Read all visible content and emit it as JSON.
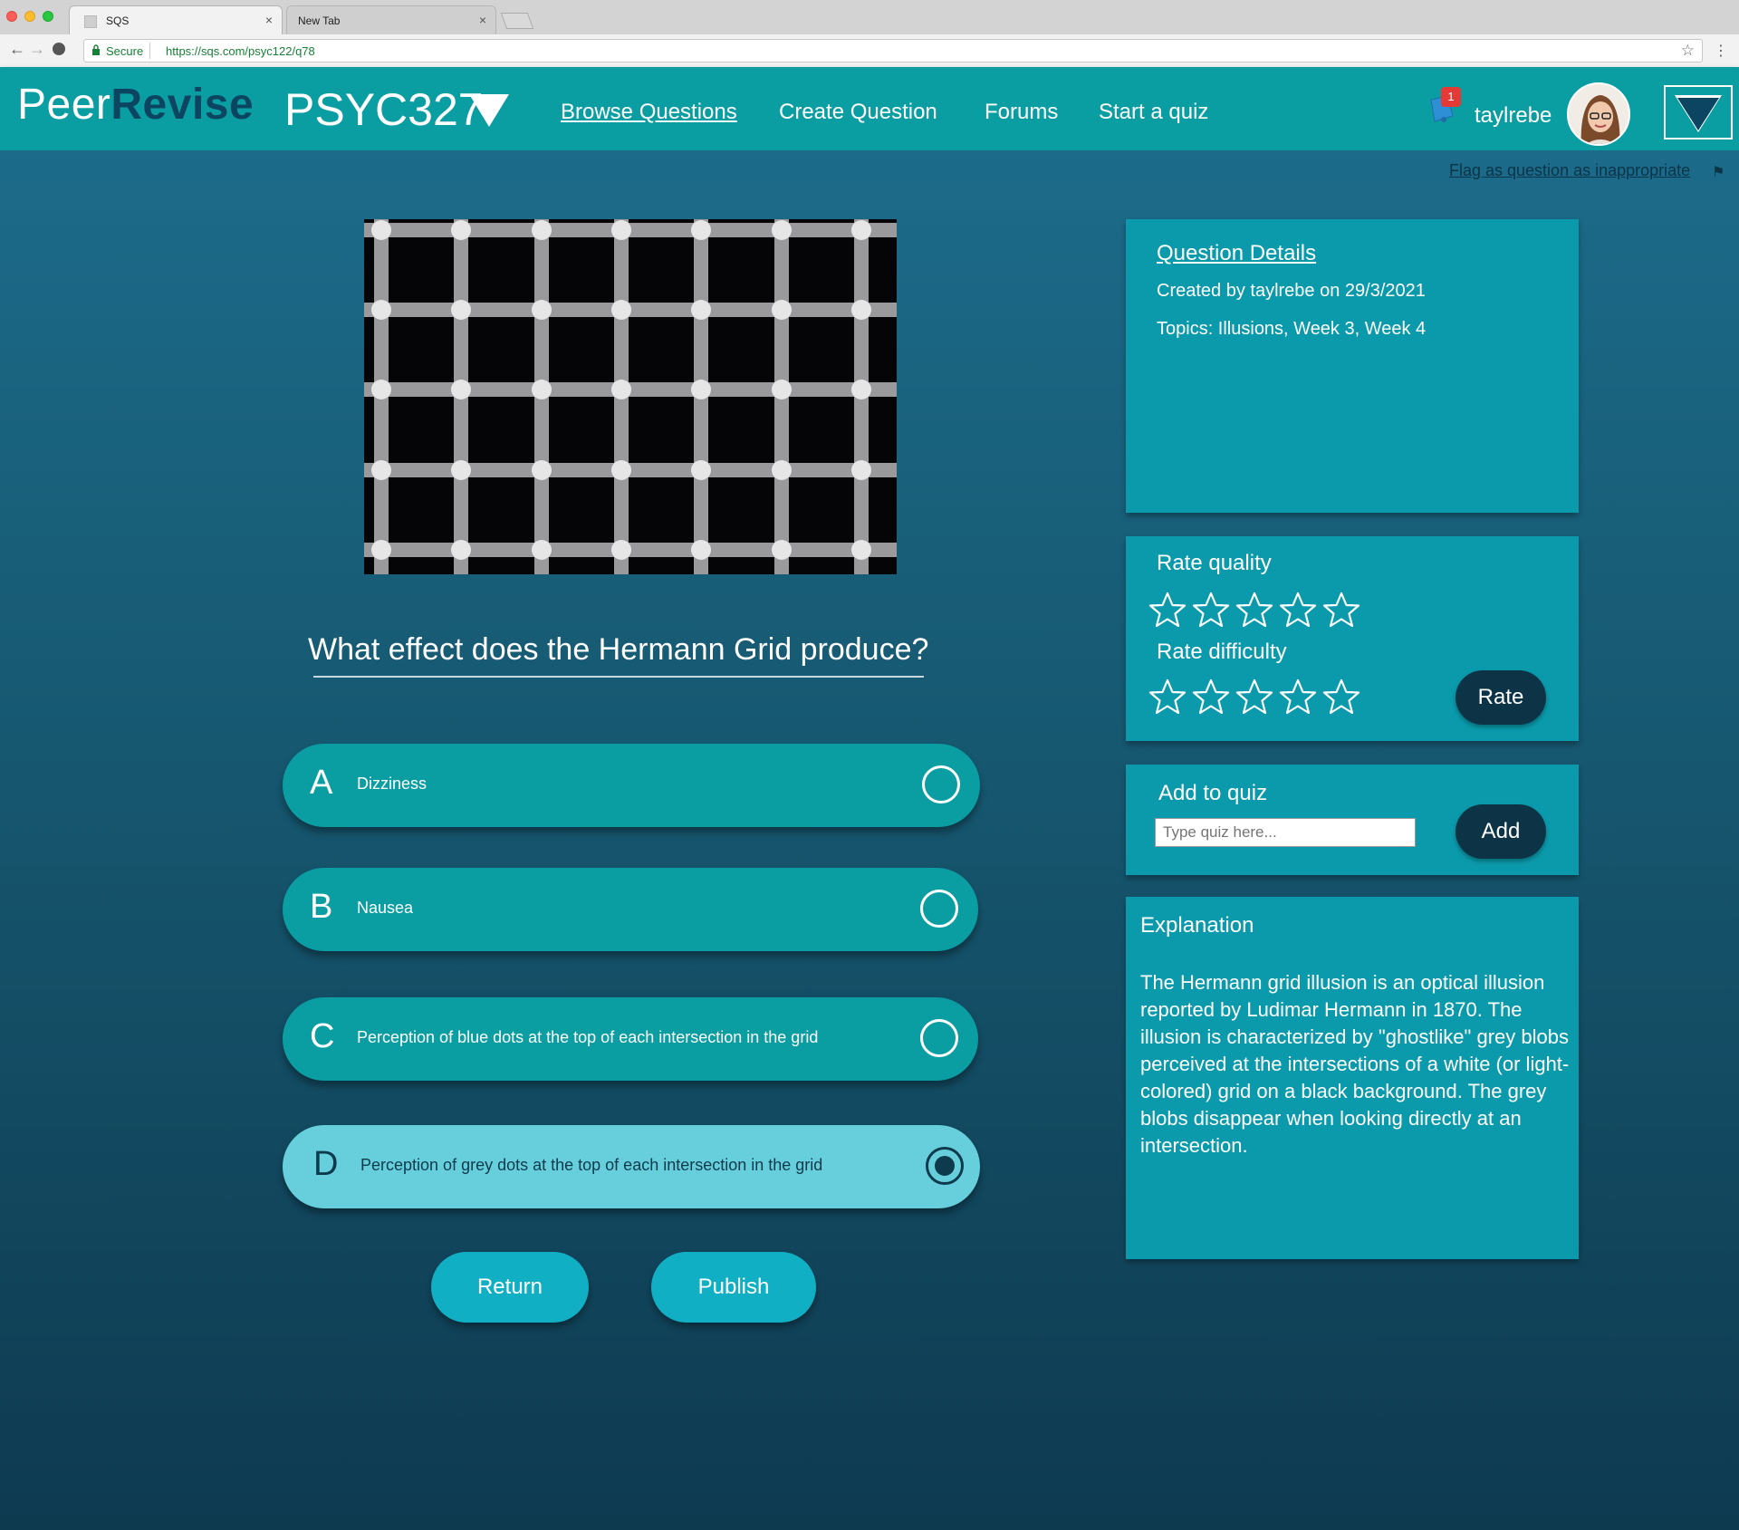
{
  "browser": {
    "tabs": [
      {
        "title": "SQS",
        "active": true
      },
      {
        "title": "New Tab",
        "active": false
      }
    ],
    "secure_label": "Secure",
    "url": "https://sqs.com/psyc122/q78"
  },
  "header": {
    "logo_part1": "Peer",
    "logo_part2": "Revise",
    "course": "PSYC327",
    "nav": [
      {
        "label": "Browse Questions",
        "current": true
      },
      {
        "label": "Create Question",
        "current": false
      },
      {
        "label": "Forums",
        "current": false
      },
      {
        "label": "Start a quiz",
        "current": false
      }
    ],
    "notification_count": "1",
    "username": "taylrebe"
  },
  "main": {
    "flag_link": "Flag as question as inappropriate",
    "question": "What effect does the Hermann Grid produce?",
    "options": [
      {
        "letter": "A",
        "text": "Dizziness",
        "selected": false
      },
      {
        "letter": "B",
        "text": "Nausea",
        "selected": false
      },
      {
        "letter": "C",
        "text": "Perception of blue dots at the top of each intersection in the grid",
        "selected": false
      },
      {
        "letter": "D",
        "text": "Perception of grey dots at the top of each intersection in the grid",
        "selected": true
      }
    ],
    "return_label": "Return",
    "publish_label": "Publish"
  },
  "details": {
    "title": "Question Details",
    "created": "Created by taylrebe on 29/3/2021",
    "topics": "Topics: Illusions, Week 3, Week 4"
  },
  "rating": {
    "quality_label": "Rate quality",
    "difficulty_label": "Rate difficulty",
    "quality_stars": 0,
    "difficulty_stars": 0,
    "max_stars": 5,
    "rate_label": "Rate"
  },
  "add_quiz": {
    "title": "Add to quiz",
    "placeholder": "Type quiz here...",
    "add_label": "Add"
  },
  "explanation": {
    "title": "Explanation",
    "body": "The Hermann grid illusion is an optical illusion reported by Ludimar Hermann in 1870. The illusion is characterized by \"ghostlike\" grey blobs perceived at the intersections of a white (or light-colored) grid on a black background. The grey blobs disappear when looking directly at an intersection."
  },
  "colors": {
    "brand_teal": "#0a9ea3",
    "brand_dark": "#0c4561",
    "selected_option": "#66cfdb",
    "button_cyan": "#11afc4"
  },
  "icons": [
    "back-arrow-icon",
    "forward-arrow-icon",
    "reload-icon",
    "lock-icon",
    "star-bookmark-icon",
    "menu-dots-icon",
    "caret-down-icon",
    "bell-icon",
    "menu-triangle-icon",
    "flag-icon",
    "star-icon"
  ]
}
